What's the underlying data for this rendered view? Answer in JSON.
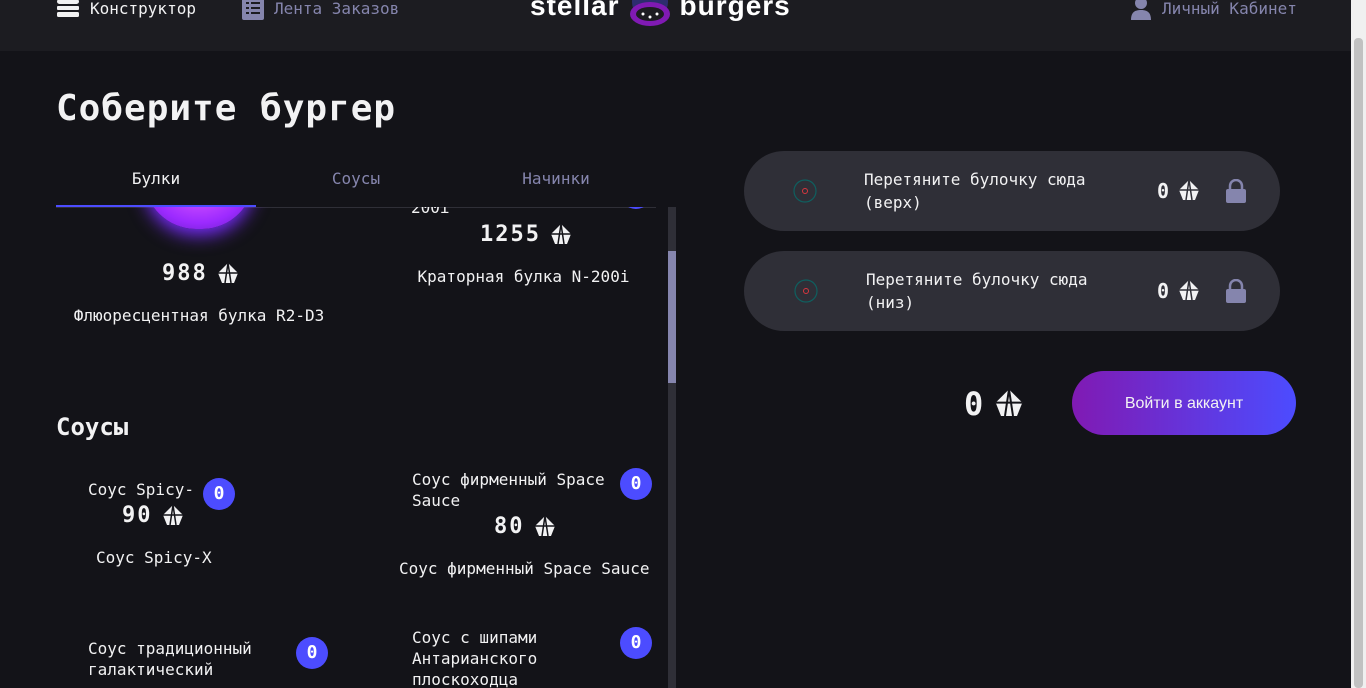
{
  "header": {
    "nav_constructor": "Конструктор",
    "nav_feed": "Лента Заказов",
    "logo_left": "stellar",
    "logo_right": "burgers",
    "nav_profile": "Личный Кабинет"
  },
  "title": "Соберите бургер",
  "tabs": [
    "Булки",
    "Соусы",
    "Начинки"
  ],
  "ingredients": {
    "buns": [
      {
        "price": "988",
        "name": "Флюоресцентная булка R2-D3"
      },
      {
        "price": "1255",
        "name": "Краторная булка N-200i",
        "img_alt_tail": "200i"
      }
    ],
    "sauces_heading": "Соусы",
    "sauces": [
      {
        "alt": "Соус Spicy-",
        "price": "90",
        "name": "Соус Spicy-X",
        "count": "0"
      },
      {
        "alt": "Соус фирменный Space Sauce",
        "price": "80",
        "name": "Соус фирменный Space Sauce",
        "count": "0"
      },
      {
        "alt": "Соус традиционный галактический",
        "count": "0"
      },
      {
        "alt": "Соус с шипами Антарианского плоскоходца",
        "count": "0"
      }
    ]
  },
  "constructor": {
    "top_text": "Перетяните булочку сюда (верх)",
    "top_price": "0",
    "bottom_text": "Перетяните булочку сюда (низ)",
    "bottom_price": "0",
    "total": "0",
    "login_label": "Войти в аккаунт"
  },
  "colors": {
    "accent": "#4c4cff",
    "background": "#131318",
    "panel": "#2f2f37",
    "muted": "#8585ad"
  }
}
